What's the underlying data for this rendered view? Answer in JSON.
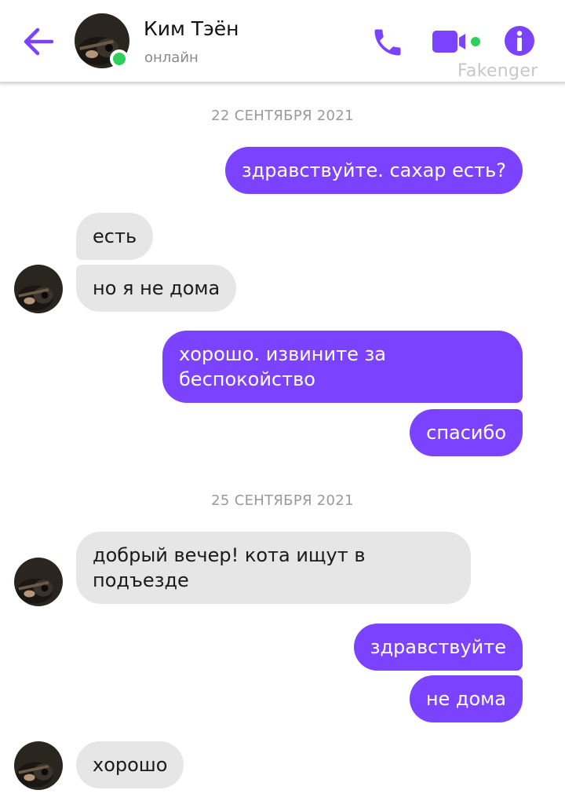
{
  "header": {
    "contact_name": "Ким Тэён",
    "status": "онлайн",
    "watermark": "Fakenger"
  },
  "icons": {
    "back": "arrow-left-icon",
    "call": "phone-icon",
    "video": "video-camera-icon",
    "info": "info-icon"
  },
  "colors": {
    "accent": "#7b42ff",
    "online": "#2fcf5c",
    "incoming_bubble": "#e6e6e6"
  },
  "chat": {
    "date_1": "22 СЕНТЯБРЯ 2021",
    "date_2": "25 СЕНТЯБРЯ 2021",
    "messages": [
      {
        "direction": "out",
        "text": "здравствуйте. сахар есть?"
      },
      {
        "direction": "in",
        "text": "есть"
      },
      {
        "direction": "in",
        "text": "но я не дома"
      },
      {
        "direction": "out",
        "text": "хорошо. извините за беспокойство"
      },
      {
        "direction": "out",
        "text": "спасибо"
      },
      {
        "direction": "in",
        "text": "добрый вечер! кота ищут в подъезде"
      },
      {
        "direction": "out",
        "text": "здравствуйте"
      },
      {
        "direction": "out",
        "text": "не дома"
      },
      {
        "direction": "in",
        "text": "хорошо"
      }
    ]
  }
}
